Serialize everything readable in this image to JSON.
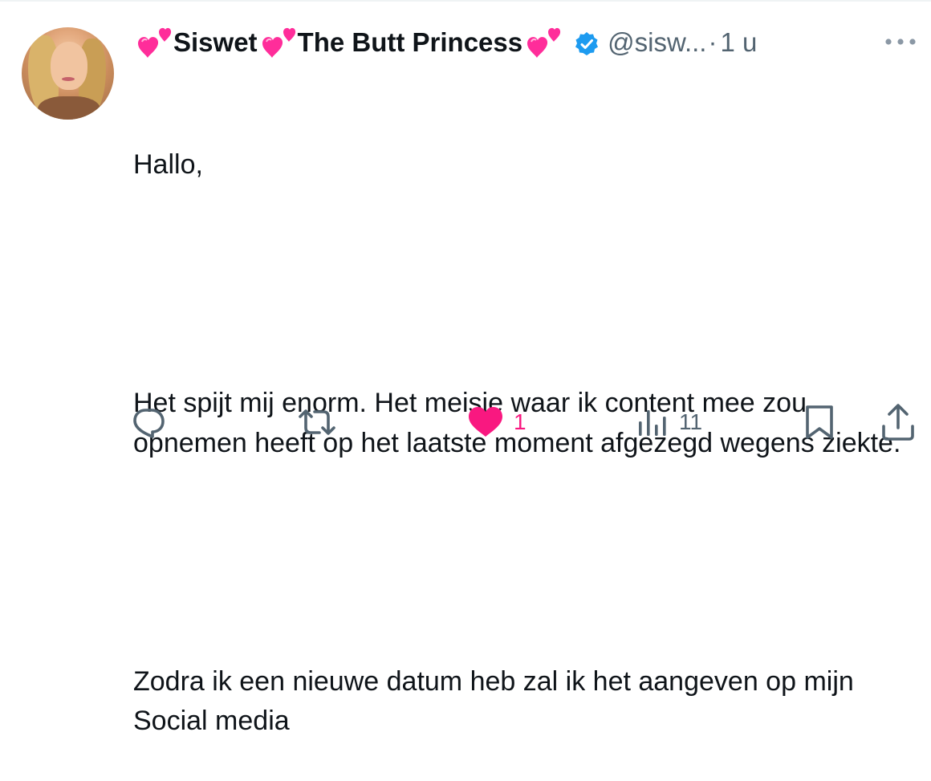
{
  "tweet": {
    "author": {
      "name_part1": "Siswet",
      "name_part2": "The Butt Princess",
      "handle": "@sisw...",
      "verified": true
    },
    "separator": "·",
    "time": "1 u",
    "text_lines": [
      "Hallo,",
      "",
      "Het spijt mij enorm. Het meisje waar ik content mee zou opnemen heeft op het laatste moment afgezegd wegens ziekte.",
      "",
      "Zodra ik een nieuwe datum heb zal ik het aangeven op mijn Social media"
    ],
    "actions": {
      "reply_icon": "reply-icon",
      "retweet_icon": "retweet-icon",
      "like_icon": "heart-filled-icon",
      "like_count": "1",
      "views_icon": "views-icon",
      "views_count": "11",
      "bookmark_icon": "bookmark-icon",
      "share_icon": "share-icon"
    }
  },
  "colors": {
    "text": "#0f1419",
    "secondary": "#536471",
    "like": "#f91880",
    "verified": "#1d9bf0",
    "emoji_heart": "#ff2d9a"
  }
}
